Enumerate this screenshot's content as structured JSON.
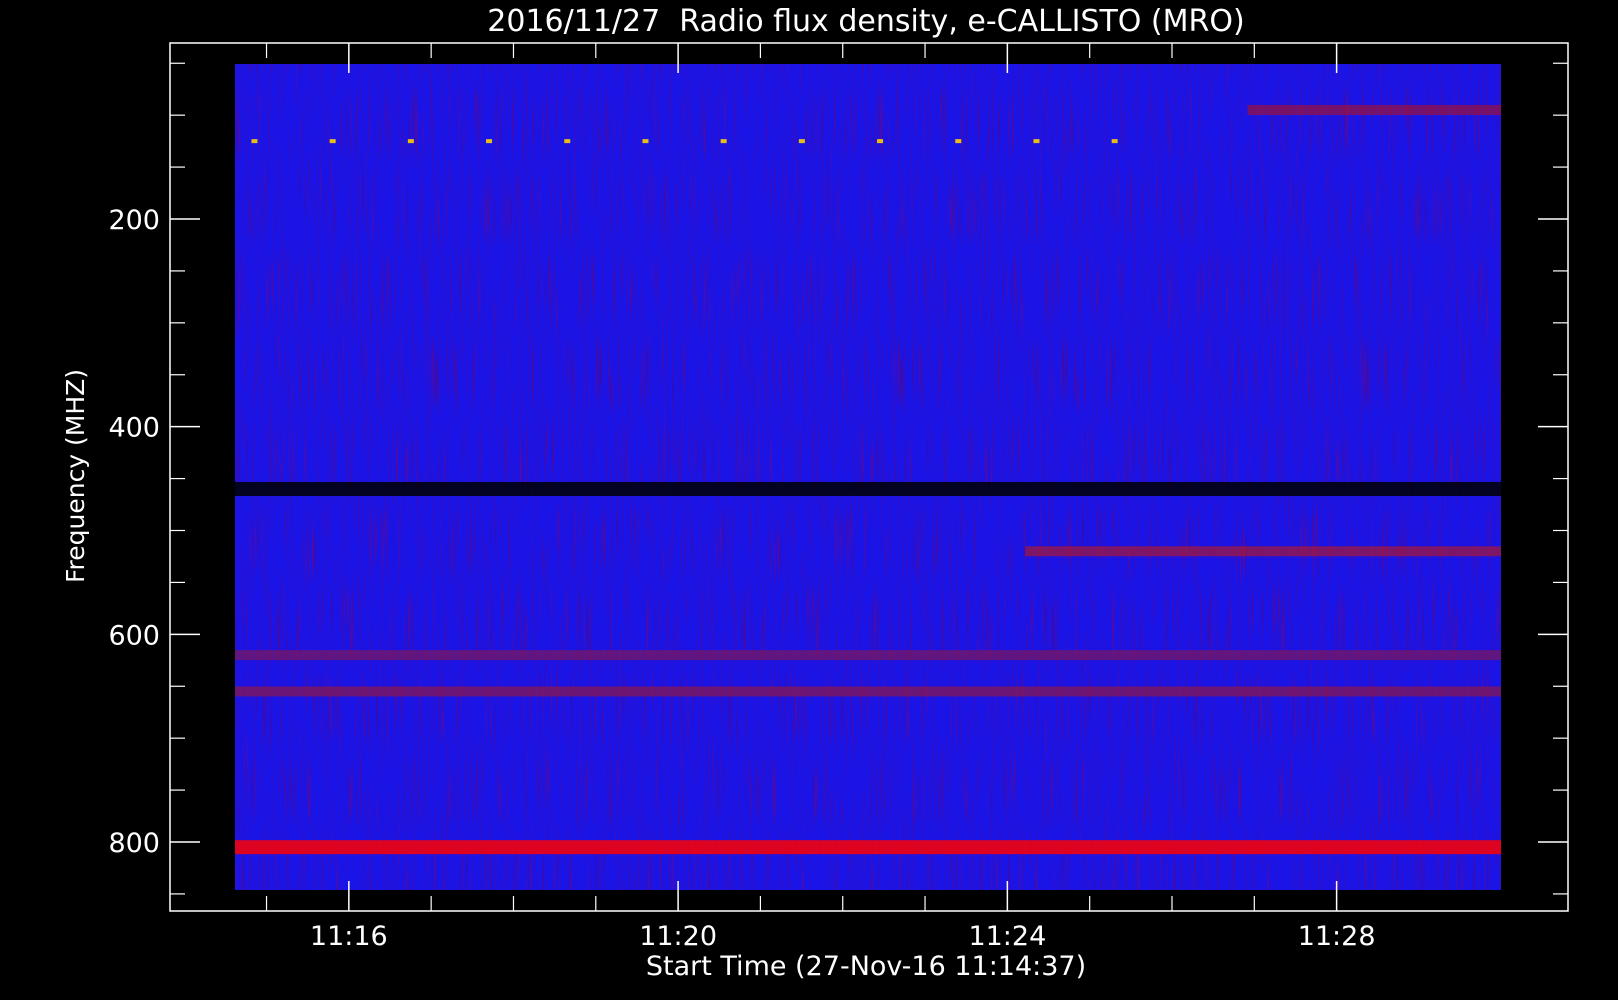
{
  "chart_data": {
    "type": "heatmap",
    "title": "2016/11/27  Radio flux density, e-CALLISTO (MRO)",
    "xlabel": "Start Time (27-Nov-16 11:14:37)",
    "ylabel": "Frequency (MHZ)",
    "x_range": [
      "11:14:37",
      "11:30:00"
    ],
    "xlim_minutes": [
      0,
      15.38
    ],
    "x_ticks": [
      {
        "label": "11:16",
        "minutes": 1.383
      },
      {
        "label": "11:20",
        "minutes": 5.383
      },
      {
        "label": "11:24",
        "minutes": 9.383
      },
      {
        "label": "11:28",
        "minutes": 13.383
      }
    ],
    "y_range_mhz": [
      45,
      870
    ],
    "y_ticks": [
      {
        "label": "200",
        "mhz": 200
      },
      {
        "label": "400",
        "mhz": 400
      },
      {
        "label": "600",
        "mhz": 600
      },
      {
        "label": "800",
        "mhz": 800
      }
    ],
    "y_direction": "inverted (frequency increases downward)",
    "grid": false,
    "colormap": [
      "#000000",
      "#0000ff",
      "#ff0000",
      "#ffff00"
    ],
    "background_color": "#000000",
    "data_fill_color": "#1a14e6",
    "features": [
      {
        "kind": "band",
        "mhz": 460,
        "color": "#000000",
        "intensity": "high"
      },
      {
        "kind": "band",
        "mhz": 805,
        "color": "#ff0000",
        "intensity": "high"
      },
      {
        "kind": "band",
        "mhz": 520,
        "color": "#c01818",
        "intensity": "medium",
        "from_minutes": 9.6
      },
      {
        "kind": "band",
        "mhz": 655,
        "color": "#a01830",
        "intensity": "medium"
      },
      {
        "kind": "band",
        "mhz": 620,
        "color": "#901840",
        "intensity": "medium"
      },
      {
        "kind": "band",
        "mhz": 95,
        "color": "#b01020",
        "intensity": "medium",
        "from_minutes": 12.3
      },
      {
        "kind": "band",
        "mhz": 125,
        "color": "#ffd000",
        "intensity": "spots"
      }
    ]
  }
}
